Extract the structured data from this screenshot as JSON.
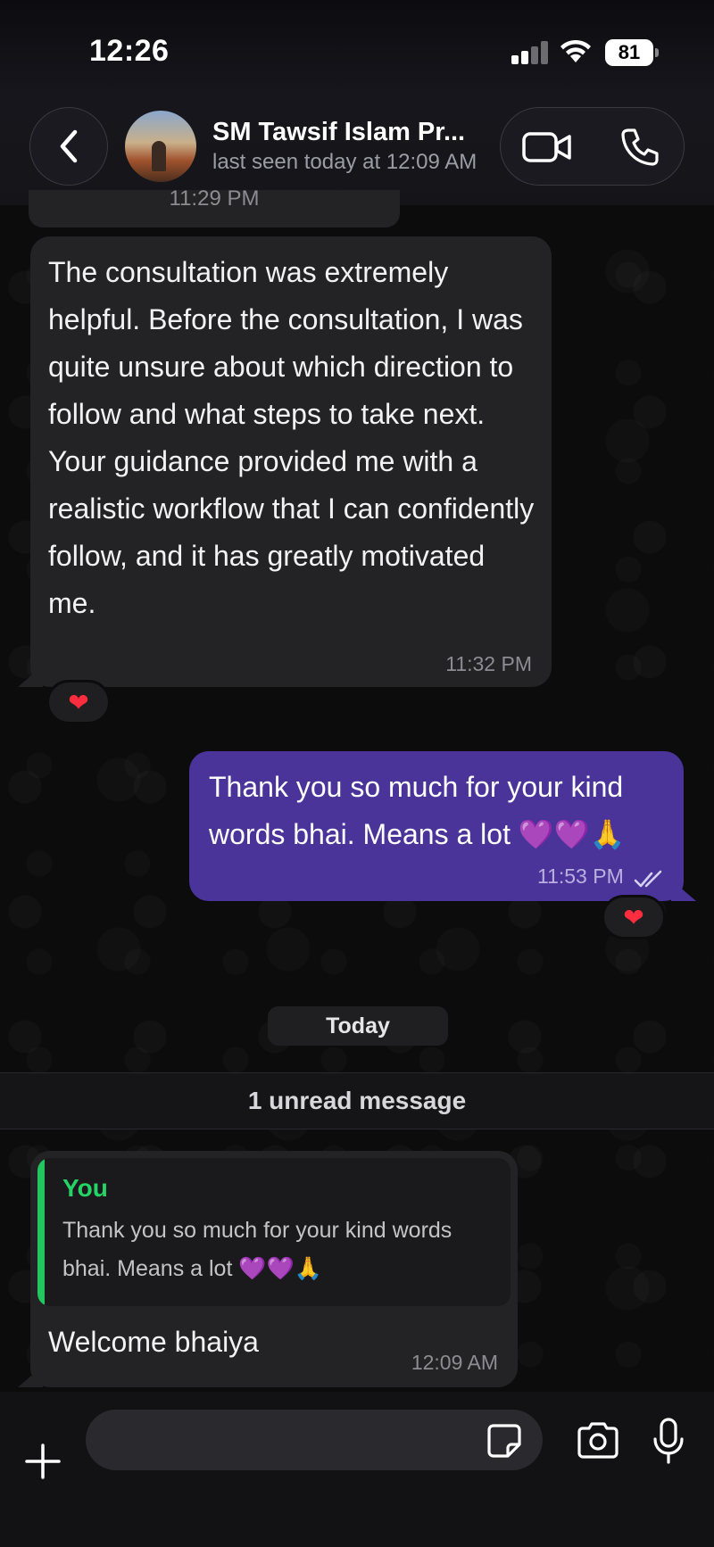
{
  "status_bar": {
    "time": "12:26",
    "battery": "81"
  },
  "header": {
    "contact_name": "SM Tawsif Islam Pr...",
    "contact_status": "last seen today at 12:09 AM"
  },
  "messages": [
    {
      "direction": "incoming",
      "partial_time": "11:29 PM"
    },
    {
      "direction": "incoming",
      "text": "The consultation was extremely helpful. Before the consultation, I was quite unsure about which direction to follow and what steps to take next. Your guidance provided me with a realistic workflow that I can confidently follow, and it has greatly motivated me.",
      "time": "11:32 PM",
      "reaction": "❤"
    },
    {
      "direction": "outgoing",
      "text": "Thank you so much for your kind words bhai. Means a lot 💜💜🙏",
      "time": "11:53 PM",
      "reaction": "❤"
    },
    {
      "direction": "incoming",
      "quote_author": "You",
      "quote_text": "Thank you so much for your kind words bhai. Means a lot 💜💜🙏",
      "text": "Welcome bhaiya",
      "time": "12:09 AM"
    }
  ],
  "day_divider": "Today",
  "unread_banner": "1 unread message",
  "composer": {
    "placeholder": ""
  },
  "colors": {
    "outgoing_bubble": "#4a3499",
    "incoming_bubble": "#232325",
    "quote_accent": "#25d366",
    "reaction_heart": "#ff2d3d"
  }
}
